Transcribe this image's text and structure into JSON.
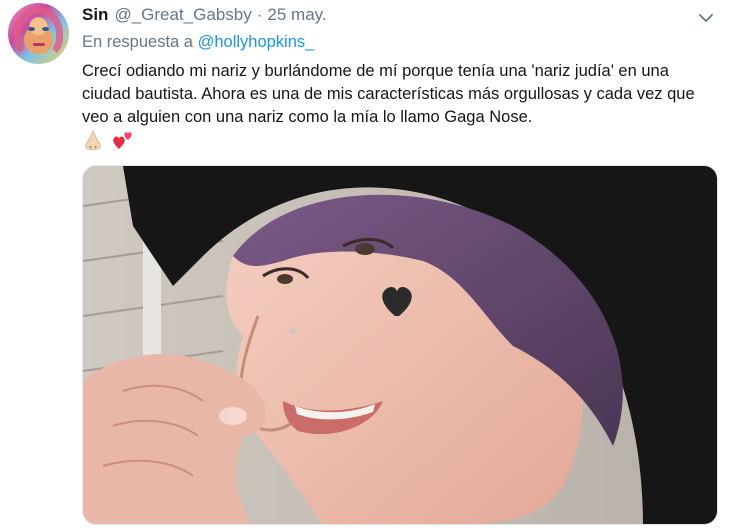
{
  "tweet": {
    "author_name": "Sin",
    "author_handle": "@_Great_Gabsby",
    "separator": "·",
    "date": "25 may.",
    "reply_prefix": "En respuesta a",
    "reply_mention": "@hollyhopkins_",
    "text": "Crecí odiando mi nariz y burlándome de mí porque tenía una 'nariz judía' en una ciudad bautista. Ahora es una de mis características más orgullosas y cada vez que veo a alguien con una nariz como la mía lo llamo Gaga Nose.",
    "emojis": [
      "nose-emoji",
      "two-hearts-emoji"
    ],
    "colors": {
      "text": "#14171a",
      "secondary": "#657786",
      "link": "#1b95e0"
    }
  }
}
